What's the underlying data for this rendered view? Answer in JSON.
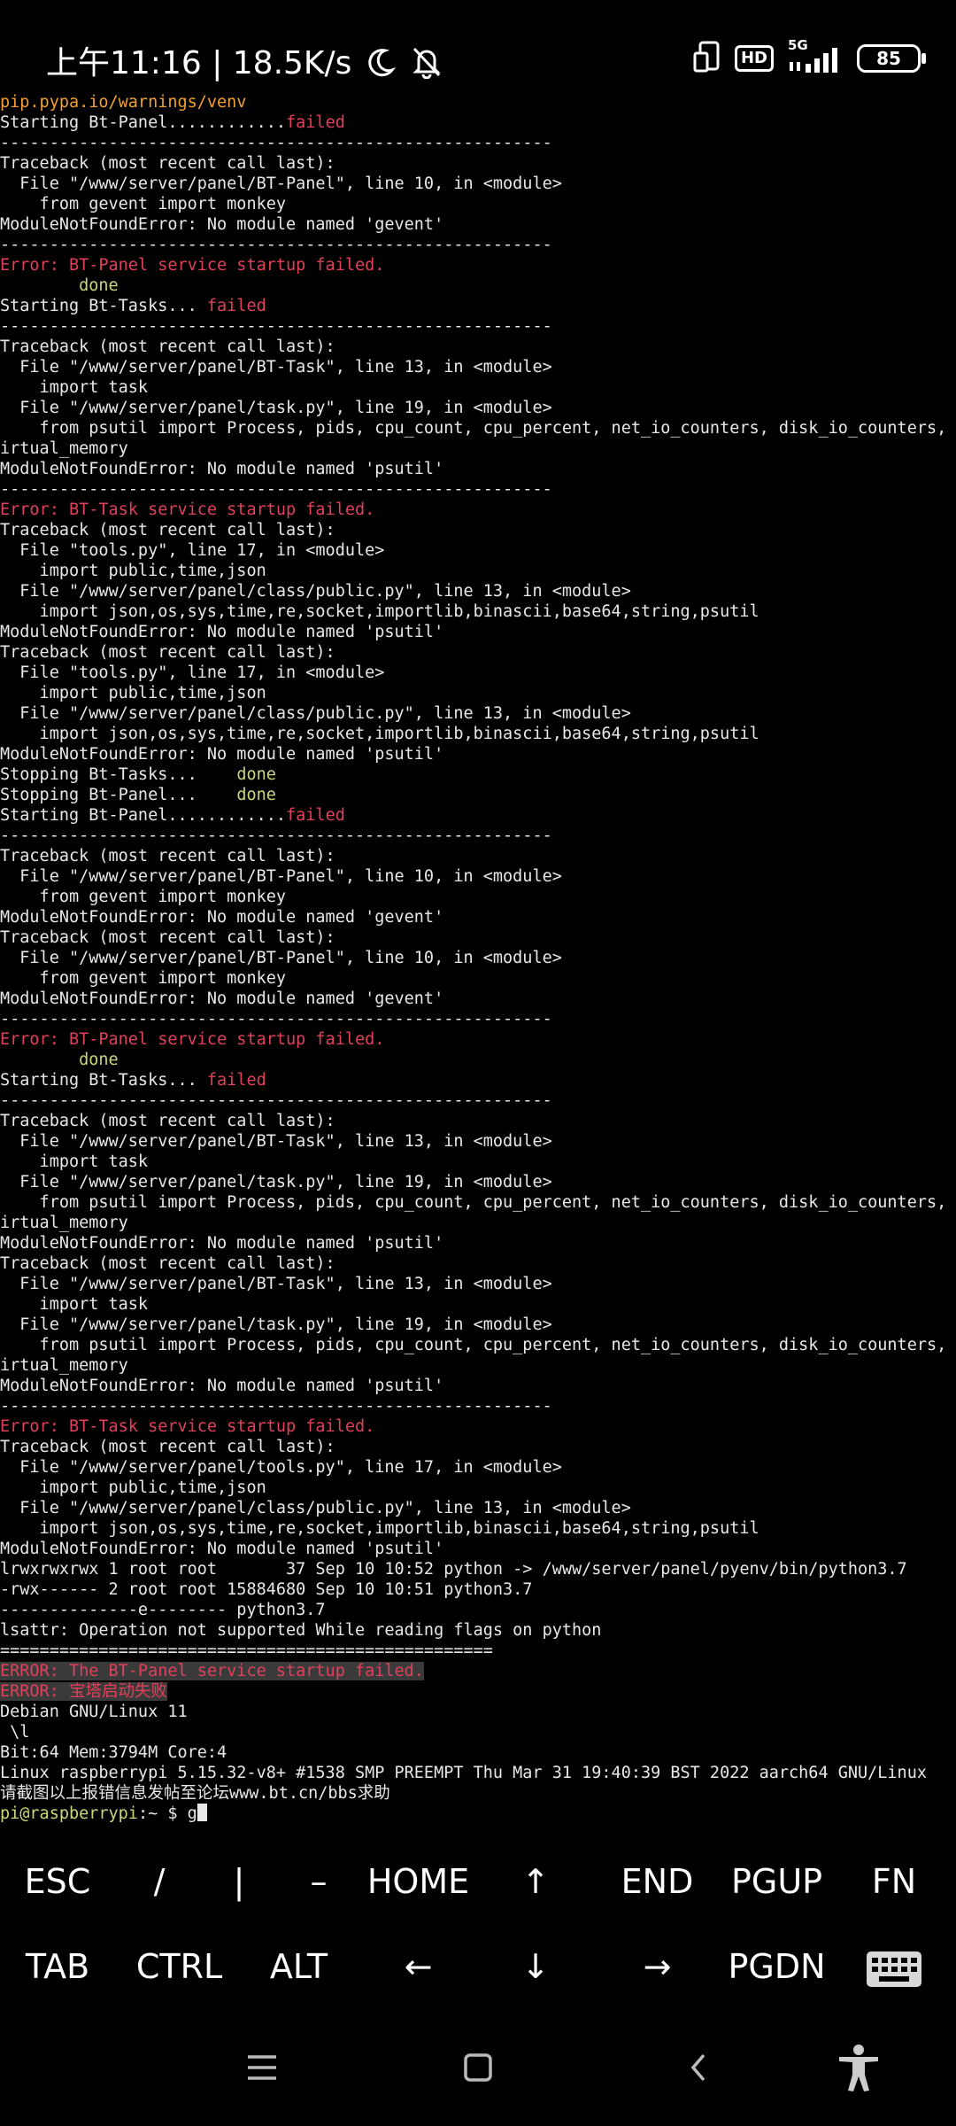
{
  "status_bar": {
    "time_text": "上午11:16 | 18.5K/s",
    "network": "5G",
    "hd": "HD",
    "battery": "85"
  },
  "terminal": {
    "lines": [
      {
        "text": "pip.pypa.io/warnings/venv",
        "color": "orange"
      },
      {
        "segs": [
          {
            "t": "Starting Bt-Panel............",
            "c": ""
          },
          {
            "t": "failed",
            "c": "red"
          }
        ]
      },
      {
        "text": "--------------------------------------------------------"
      },
      {
        "text": "Traceback (most recent call last):"
      },
      {
        "text": "  File \"/www/server/panel/BT-Panel\", line 10, in <module>"
      },
      {
        "text": "    from gevent import monkey"
      },
      {
        "text": "ModuleNotFoundError: No module named 'gevent'"
      },
      {
        "text": "--------------------------------------------------------"
      },
      {
        "text": "Error: BT-Panel service startup failed.",
        "color": "red"
      },
      {
        "text": "        done",
        "color": "green"
      },
      {
        "segs": [
          {
            "t": "Starting Bt-Tasks... ",
            "c": ""
          },
          {
            "t": "failed",
            "c": "red"
          }
        ]
      },
      {
        "text": "--------------------------------------------------------"
      },
      {
        "text": "Traceback (most recent call last):"
      },
      {
        "text": "  File \"/www/server/panel/BT-Task\", line 13, in <module>"
      },
      {
        "text": "    import task"
      },
      {
        "text": "  File \"/www/server/panel/task.py\", line 19, in <module>"
      },
      {
        "text": "    from psutil import Process, pids, cpu_count, cpu_percent, net_io_counters, disk_io_counters, v"
      },
      {
        "text": "irtual_memory"
      },
      {
        "text": "ModuleNotFoundError: No module named 'psutil'"
      },
      {
        "text": "--------------------------------------------------------"
      },
      {
        "text": "Error: BT-Task service startup failed.",
        "color": "red"
      },
      {
        "text": "Traceback (most recent call last):"
      },
      {
        "text": "  File \"tools.py\", line 17, in <module>"
      },
      {
        "text": "    import public,time,json"
      },
      {
        "text": "  File \"/www/server/panel/class/public.py\", line 13, in <module>"
      },
      {
        "text": "    import json,os,sys,time,re,socket,importlib,binascii,base64,string,psutil"
      },
      {
        "text": "ModuleNotFoundError: No module named 'psutil'"
      },
      {
        "text": "Traceback (most recent call last):"
      },
      {
        "text": "  File \"tools.py\", line 17, in <module>"
      },
      {
        "text": "    import public,time,json"
      },
      {
        "text": "  File \"/www/server/panel/class/public.py\", line 13, in <module>"
      },
      {
        "text": "    import json,os,sys,time,re,socket,importlib,binascii,base64,string,psutil"
      },
      {
        "text": "ModuleNotFoundError: No module named 'psutil'"
      },
      {
        "segs": [
          {
            "t": "Stopping Bt-Tasks...    ",
            "c": ""
          },
          {
            "t": "done",
            "c": "green"
          }
        ]
      },
      {
        "segs": [
          {
            "t": "Stopping Bt-Panel...    ",
            "c": ""
          },
          {
            "t": "done",
            "c": "green"
          }
        ]
      },
      {
        "segs": [
          {
            "t": "Starting Bt-Panel............",
            "c": ""
          },
          {
            "t": "failed",
            "c": "red"
          }
        ]
      },
      {
        "text": "--------------------------------------------------------"
      },
      {
        "text": "Traceback (most recent call last):"
      },
      {
        "text": "  File \"/www/server/panel/BT-Panel\", line 10, in <module>"
      },
      {
        "text": "    from gevent import monkey"
      },
      {
        "text": "ModuleNotFoundError: No module named 'gevent'"
      },
      {
        "text": "Traceback (most recent call last):"
      },
      {
        "text": "  File \"/www/server/panel/BT-Panel\", line 10, in <module>"
      },
      {
        "text": "    from gevent import monkey"
      },
      {
        "text": "ModuleNotFoundError: No module named 'gevent'"
      },
      {
        "text": "--------------------------------------------------------"
      },
      {
        "text": "Error: BT-Panel service startup failed.",
        "color": "red"
      },
      {
        "text": "        done",
        "color": "green"
      },
      {
        "segs": [
          {
            "t": "Starting Bt-Tasks... ",
            "c": ""
          },
          {
            "t": "failed",
            "c": "red"
          }
        ]
      },
      {
        "text": "--------------------------------------------------------"
      },
      {
        "text": "Traceback (most recent call last):"
      },
      {
        "text": "  File \"/www/server/panel/BT-Task\", line 13, in <module>"
      },
      {
        "text": "    import task"
      },
      {
        "text": "  File \"/www/server/panel/task.py\", line 19, in <module>"
      },
      {
        "text": "    from psutil import Process, pids, cpu_count, cpu_percent, net_io_counters, disk_io_counters, v"
      },
      {
        "text": "irtual_memory"
      },
      {
        "text": "ModuleNotFoundError: No module named 'psutil'"
      },
      {
        "text": "Traceback (most recent call last):"
      },
      {
        "text": "  File \"/www/server/panel/BT-Task\", line 13, in <module>"
      },
      {
        "text": "    import task"
      },
      {
        "text": "  File \"/www/server/panel/task.py\", line 19, in <module>"
      },
      {
        "text": "    from psutil import Process, pids, cpu_count, cpu_percent, net_io_counters, disk_io_counters, v"
      },
      {
        "text": "irtual_memory"
      },
      {
        "text": "ModuleNotFoundError: No module named 'psutil'"
      },
      {
        "text": "--------------------------------------------------------"
      },
      {
        "text": "Error: BT-Task service startup failed.",
        "color": "red"
      },
      {
        "text": "Traceback (most recent call last):"
      },
      {
        "text": "  File \"/www/server/panel/tools.py\", line 17, in <module>"
      },
      {
        "text": "    import public,time,json"
      },
      {
        "text": "  File \"/www/server/panel/class/public.py\", line 13, in <module>"
      },
      {
        "text": "    import json,os,sys,time,re,socket,importlib,binascii,base64,string,psutil"
      },
      {
        "text": "ModuleNotFoundError: No module named 'psutil'"
      },
      {
        "text": "lrwxrwxrwx 1 root root       37 Sep 10 10:52 python -> /www/server/panel/pyenv/bin/python3.7"
      },
      {
        "text": "-rwx------ 2 root root 15884680 Sep 10 10:51 python3.7"
      },
      {
        "text": "--------------e-------- python3.7"
      },
      {
        "text": "lsattr: Operation not supported While reading flags on python"
      },
      {
        "text": "=================================================="
      },
      {
        "text": "ERROR: The BT-Panel service startup failed.",
        "color": "hl"
      },
      {
        "text": "ERROR: 宝塔启动失败",
        "color": "hl"
      },
      {
        "text": "Debian GNU/Linux 11"
      },
      {
        "text": " \\l"
      },
      {
        "text": "Bit:64 Mem:3794M Core:4"
      },
      {
        "text": "Linux raspberrypi 5.15.32-v8+ #1538 SMP PREEMPT Thu Mar 31 19:40:39 BST 2022 aarch64 GNU/Linux"
      },
      {
        "text": "请截图以上报错信息发帖至论坛www.bt.cn/bbs求助"
      }
    ],
    "prompt": {
      "user_host": "pi@raspberrypi",
      "path": ":~ $ ",
      "input": "g"
    }
  },
  "extra_keys": {
    "row1": [
      "ESC",
      "/",
      "|",
      "–",
      "HOME",
      "↑",
      "END",
      "PGUP",
      "FN"
    ],
    "row2": [
      "TAB",
      "CTRL",
      "ALT",
      "←",
      "↓",
      "→",
      "PGDN"
    ],
    "keyboard_icon": "keyboard-icon"
  },
  "nav_bar": {
    "icons": [
      "menu-icon",
      "home-icon",
      "back-icon",
      "accessibility-icon"
    ]
  }
}
